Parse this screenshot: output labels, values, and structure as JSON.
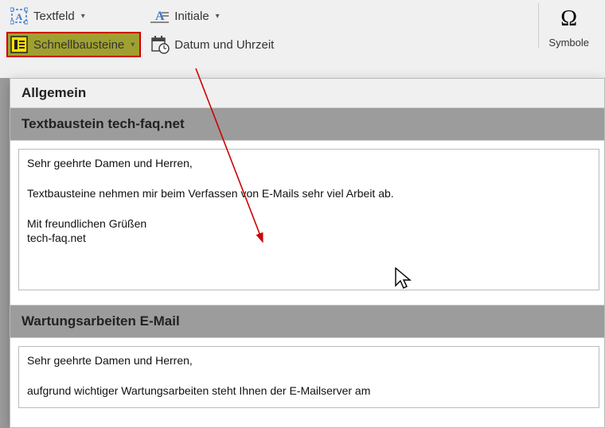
{
  "ribbon": {
    "textbox": "Textfeld",
    "quickparts": "Schnellbausteine",
    "initials": "Initiale",
    "datetime": "Datum und Uhrzeit",
    "symbols_label": "Symbole",
    "symbols_glyph": "Ω"
  },
  "gallery": {
    "category": "Allgemein",
    "items": [
      {
        "title": "Textbaustein tech-faq.net",
        "body": "Sehr geehrte Damen und Herren,\n\nTextbausteine nehmen mir beim Verfassen von E-Mails sehr viel Arbeit ab.\n\nMit freundlichen Grüßen\ntech-faq.net"
      },
      {
        "title": "Wartungsarbeiten E-Mail",
        "body": "Sehr geehrte Damen und Herren,\n\naufgrund wichtiger Wartungsarbeiten steht Ihnen der E-Mailserver am"
      }
    ]
  }
}
